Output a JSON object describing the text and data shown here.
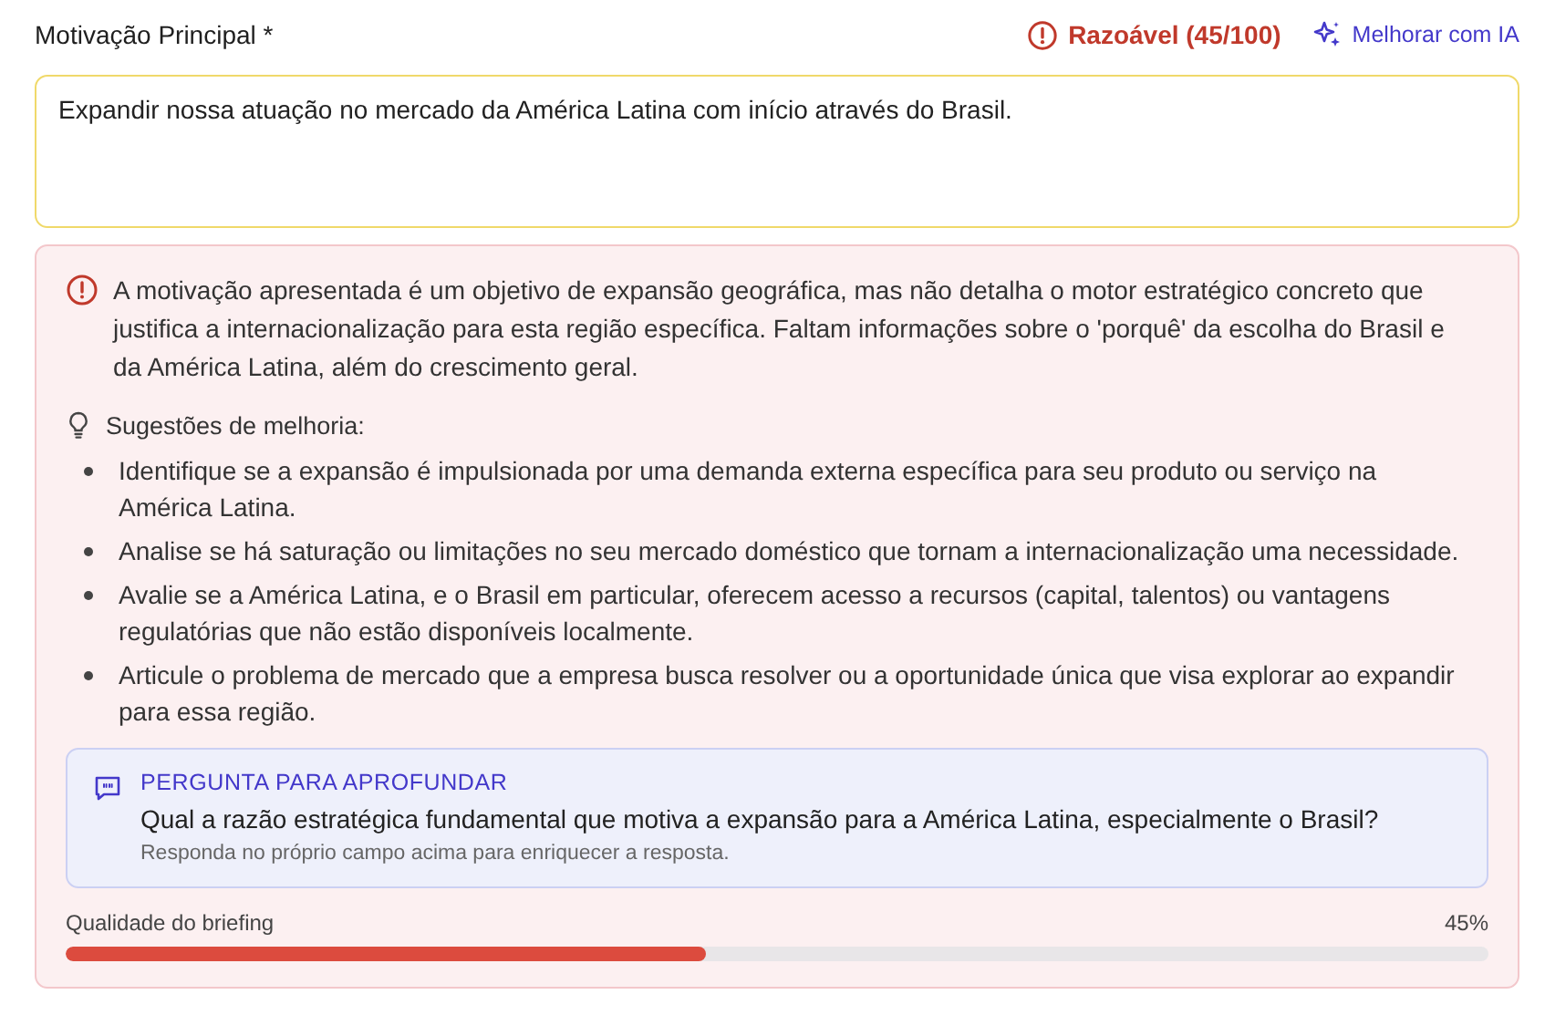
{
  "field": {
    "label": "Motivação Principal *",
    "rating": {
      "kind": "warning",
      "text": "Razoável (45/100)"
    },
    "improve_button": "Melhorar com IA",
    "value": "Expandir nossa atuação no mercado da América Latina com início através do Brasil."
  },
  "feedback": {
    "message": "A motivação apresentada é um objetivo de expansão geográfica, mas não detalha o motor estratégico concreto que justifica a internacionalização para esta região específica. Faltam informações sobre o 'porquê' da escolha do Brasil e da América Latina, além do crescimento geral.",
    "suggestions_title": "Sugestões de melhoria:",
    "suggestions": [
      "Identifique se a expansão é impulsionada por uma demanda externa específica para seu produto ou serviço na América Latina.",
      "Analise se há saturação ou limitações no seu mercado doméstico que tornam a internacionalização uma necessidade.",
      "Avalie se a América Latina, e o Brasil em particular, oferecem acesso a recursos (capital, talentos) ou vantagens regulatórias que não estão disponíveis localmente.",
      "Articule o problema de mercado que a empresa busca resolver ou a oportunidade única que visa explorar ao expandir para essa região."
    ],
    "question": {
      "heading": "PERGUNTA PARA APROFUNDAR",
      "text": "Qual a razão estratégica fundamental que motiva a expansão para a América Latina, especialmente o Brasil?",
      "hint": "Responda no próprio campo acima para enriquecer a resposta."
    },
    "quality": {
      "label": "Qualidade do briefing",
      "reading": "45%",
      "level": 0.45
    }
  }
}
